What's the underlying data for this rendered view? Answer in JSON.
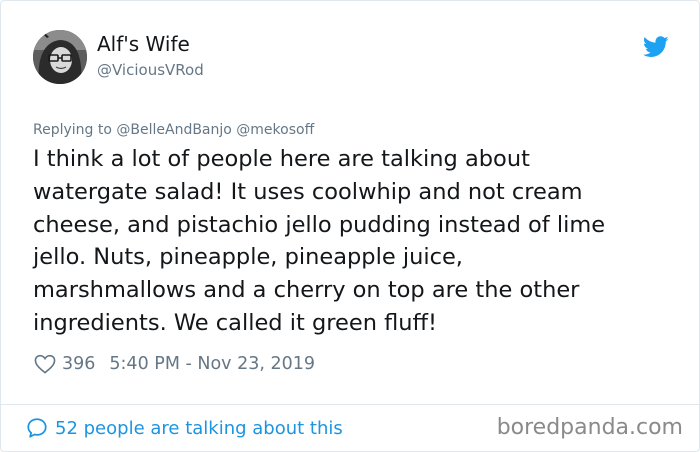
{
  "tweet": {
    "author_name": "Alf's Wife",
    "author_handle": "@ViciousVRod",
    "reply_prefix": "Replying to @BelleAndBanjo @mekosoff",
    "text_lines": [
      "I think a lot of people here are talking about",
      "watergate salad! It uses coolwhip and not cream",
      "cheese, and pistachio jello pudding instead of lime",
      "jello. Nuts, pineapple, pineapple juice,",
      "marshmallows and a cherry on top are the other",
      "ingredients. We called it green fluff!"
    ],
    "likes": "396",
    "timestamp": "5:40 PM - Nov 23, 2019",
    "talking": "52 people are talking about this"
  },
  "watermark": "boredpanda.com",
  "icons": {
    "bird": "twitter-bird-icon",
    "heart": "heart-icon",
    "bubble": "speech-bubble-icon"
  },
  "colors": {
    "twitter_blue": "#1da1f2",
    "link_blue": "#1b95e0",
    "muted_gray": "#657786",
    "text_dark": "#14171a"
  }
}
